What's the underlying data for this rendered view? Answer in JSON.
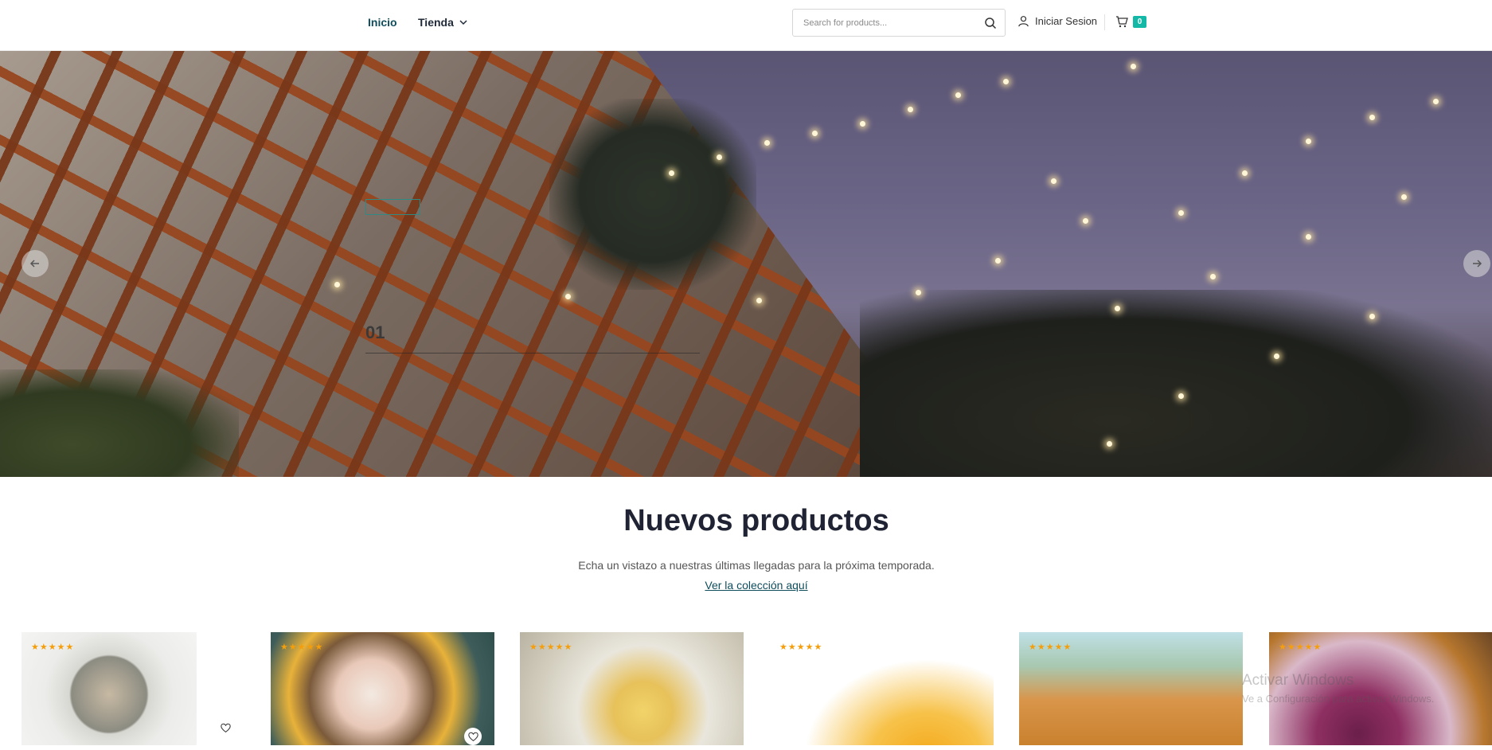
{
  "nav": {
    "inicio": "Inicio",
    "tienda": "Tienda"
  },
  "search": {
    "placeholder": "Search for products..."
  },
  "account": {
    "login": "Iniciar Sesion"
  },
  "cart": {
    "count": "0"
  },
  "hero": {
    "slide_number": "01"
  },
  "section": {
    "title": "Nuevos productos",
    "subtitle": "Echa un vistazo a nuestras últimas llegadas para la próxima temporada.",
    "link": "Ver la colección aquí"
  },
  "products": [
    {
      "rating": "★★★★★",
      "image": "pasta-salad"
    },
    {
      "rating": "★★★★★",
      "image": "ceviche"
    },
    {
      "rating": "★★★★★",
      "image": "causa-dish"
    },
    {
      "rating": "★★★★★",
      "image": "passion-fruit-juice"
    },
    {
      "rating": "★★★★★",
      "image": "juice-pitcher"
    },
    {
      "rating": "★★★★★",
      "image": "chicha-morada"
    }
  ],
  "watermark": {
    "line1": "Activar Windows",
    "line2": "Ve a Configuración para activar Windows."
  },
  "colors": {
    "accent": "#0f4d5c",
    "badge": "#14b8a6",
    "stars": "#f59e0b"
  }
}
